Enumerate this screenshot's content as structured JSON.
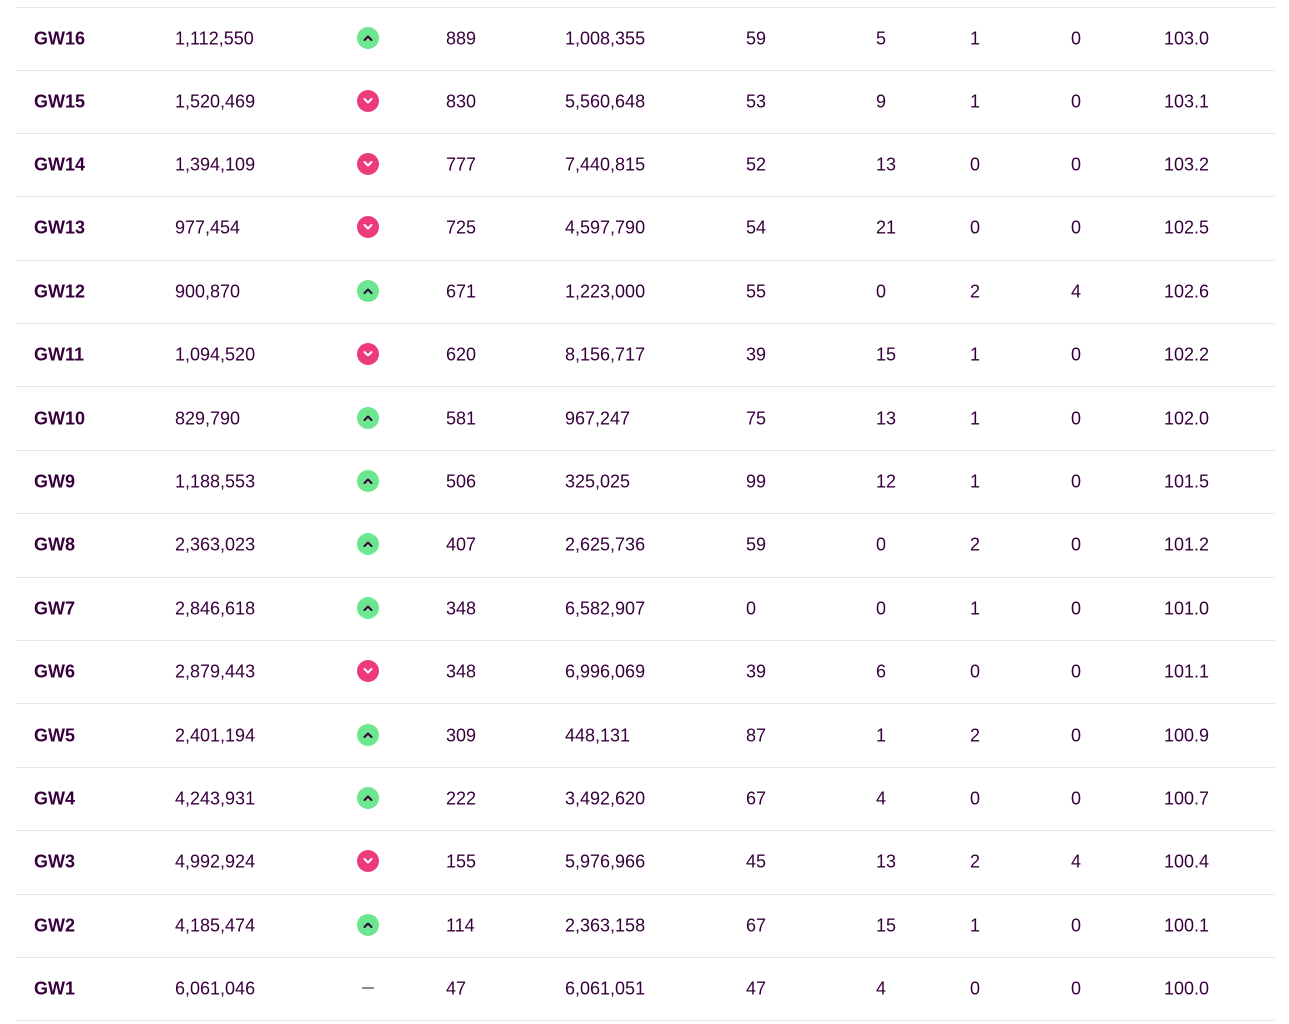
{
  "colors": {
    "text": "#37003c",
    "up": "#6de690",
    "down": "#eb3b7c",
    "same": "#8a8a96",
    "divider": "#e6e6ec"
  },
  "rows": [
    {
      "gw": "GW16",
      "points": "1,112,550",
      "movement": "up",
      "overall_points": "889",
      "rank": "1,008,355",
      "transfer_cost_or_tm": "59",
      "bench": "5",
      "transfers": "1",
      "cost": "0",
      "value": "103.0"
    },
    {
      "gw": "GW15",
      "points": "1,520,469",
      "movement": "down",
      "overall_points": "830",
      "rank": "5,560,648",
      "transfer_cost_or_tm": "53",
      "bench": "9",
      "transfers": "1",
      "cost": "0",
      "value": "103.1"
    },
    {
      "gw": "GW14",
      "points": "1,394,109",
      "movement": "down",
      "overall_points": "777",
      "rank": "7,440,815",
      "transfer_cost_or_tm": "52",
      "bench": "13",
      "transfers": "0",
      "cost": "0",
      "value": "103.2"
    },
    {
      "gw": "GW13",
      "points": "977,454",
      "movement": "down",
      "overall_points": "725",
      "rank": "4,597,790",
      "transfer_cost_or_tm": "54",
      "bench": "21",
      "transfers": "0",
      "cost": "0",
      "value": "102.5"
    },
    {
      "gw": "GW12",
      "points": "900,870",
      "movement": "up",
      "overall_points": "671",
      "rank": "1,223,000",
      "transfer_cost_or_tm": "55",
      "bench": "0",
      "transfers": "2",
      "cost": "4",
      "value": "102.6"
    },
    {
      "gw": "GW11",
      "points": "1,094,520",
      "movement": "down",
      "overall_points": "620",
      "rank": "8,156,717",
      "transfer_cost_or_tm": "39",
      "bench": "15",
      "transfers": "1",
      "cost": "0",
      "value": "102.2"
    },
    {
      "gw": "GW10",
      "points": "829,790",
      "movement": "up",
      "overall_points": "581",
      "rank": "967,247",
      "transfer_cost_or_tm": "75",
      "bench": "13",
      "transfers": "1",
      "cost": "0",
      "value": "102.0"
    },
    {
      "gw": "GW9",
      "points": "1,188,553",
      "movement": "up",
      "overall_points": "506",
      "rank": "325,025",
      "transfer_cost_or_tm": "99",
      "bench": "12",
      "transfers": "1",
      "cost": "0",
      "value": "101.5"
    },
    {
      "gw": "GW8",
      "points": "2,363,023",
      "movement": "up",
      "overall_points": "407",
      "rank": "2,625,736",
      "transfer_cost_or_tm": "59",
      "bench": "0",
      "transfers": "2",
      "cost": "0",
      "value": "101.2"
    },
    {
      "gw": "GW7",
      "points": "2,846,618",
      "movement": "up",
      "overall_points": "348",
      "rank": "6,582,907",
      "transfer_cost_or_tm": "0",
      "bench": "0",
      "transfers": "1",
      "cost": "0",
      "value": "101.0"
    },
    {
      "gw": "GW6",
      "points": "2,879,443",
      "movement": "down",
      "overall_points": "348",
      "rank": "6,996,069",
      "transfer_cost_or_tm": "39",
      "bench": "6",
      "transfers": "0",
      "cost": "0",
      "value": "101.1"
    },
    {
      "gw": "GW5",
      "points": "2,401,194",
      "movement": "up",
      "overall_points": "309",
      "rank": "448,131",
      "transfer_cost_or_tm": "87",
      "bench": "1",
      "transfers": "2",
      "cost": "0",
      "value": "100.9"
    },
    {
      "gw": "GW4",
      "points": "4,243,931",
      "movement": "up",
      "overall_points": "222",
      "rank": "3,492,620",
      "transfer_cost_or_tm": "67",
      "bench": "4",
      "transfers": "0",
      "cost": "0",
      "value": "100.7"
    },
    {
      "gw": "GW3",
      "points": "4,992,924",
      "movement": "down",
      "overall_points": "155",
      "rank": "5,976,966",
      "transfer_cost_or_tm": "45",
      "bench": "13",
      "transfers": "2",
      "cost": "4",
      "value": "100.4"
    },
    {
      "gw": "GW2",
      "points": "4,185,474",
      "movement": "up",
      "overall_points": "114",
      "rank": "2,363,158",
      "transfer_cost_or_tm": "67",
      "bench": "15",
      "transfers": "1",
      "cost": "0",
      "value": "100.1"
    },
    {
      "gw": "GW1",
      "points": "6,061,046",
      "movement": "same",
      "overall_points": "47",
      "rank": "6,061,051",
      "transfer_cost_or_tm": "47",
      "bench": "4",
      "transfers": "0",
      "cost": "0",
      "value": "100.0"
    }
  ]
}
